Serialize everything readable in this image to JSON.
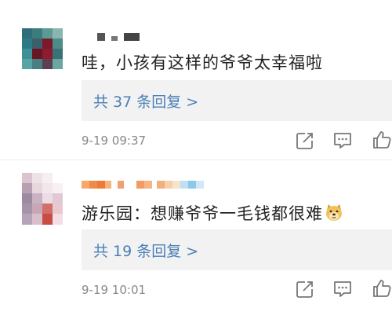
{
  "comments": [
    {
      "text": "哇，小孩有这样的爷爷太幸福啦",
      "replies": "共 37 条回复 >",
      "time": "9-19 09:37"
    },
    {
      "text": "游乐园：想赚爷爷一毛钱都很难",
      "replies": "共 19 条回复 >",
      "time": "9-19 10:01"
    }
  ],
  "icons": {
    "repost": "repost-icon",
    "comment": "comment-icon",
    "like": "like-icon",
    "emoji": "doge-emoji-icon"
  },
  "colors": {
    "link": "#4a7fb5",
    "time": "#888888",
    "text": "#222222",
    "reply_bg": "#f2f2f2",
    "icon": "#777777"
  }
}
